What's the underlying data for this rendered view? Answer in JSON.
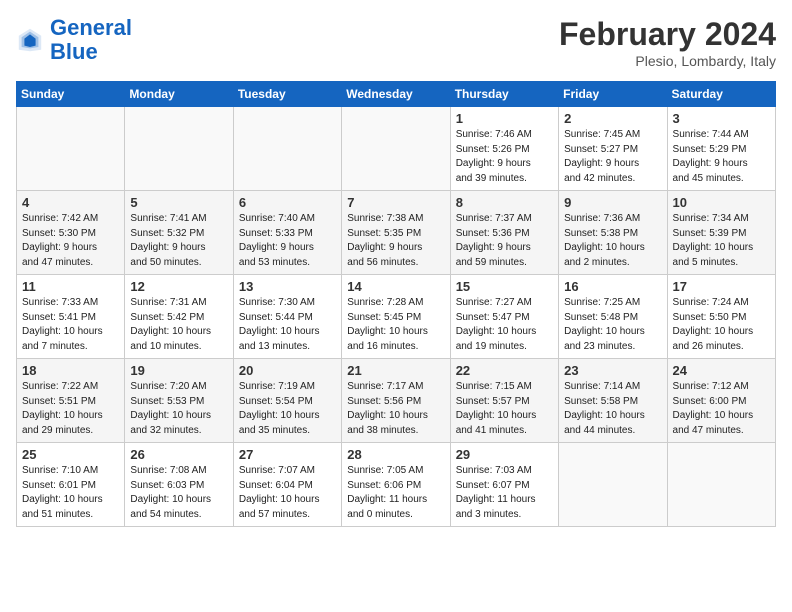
{
  "header": {
    "logo_general": "General",
    "logo_blue": "Blue",
    "month_year": "February 2024",
    "location": "Plesio, Lombardy, Italy"
  },
  "days_of_week": [
    "Sunday",
    "Monday",
    "Tuesday",
    "Wednesday",
    "Thursday",
    "Friday",
    "Saturday"
  ],
  "weeks": [
    [
      {
        "day": "",
        "info": ""
      },
      {
        "day": "",
        "info": ""
      },
      {
        "day": "",
        "info": ""
      },
      {
        "day": "",
        "info": ""
      },
      {
        "day": "1",
        "info": "Sunrise: 7:46 AM\nSunset: 5:26 PM\nDaylight: 9 hours\nand 39 minutes."
      },
      {
        "day": "2",
        "info": "Sunrise: 7:45 AM\nSunset: 5:27 PM\nDaylight: 9 hours\nand 42 minutes."
      },
      {
        "day": "3",
        "info": "Sunrise: 7:44 AM\nSunset: 5:29 PM\nDaylight: 9 hours\nand 45 minutes."
      }
    ],
    [
      {
        "day": "4",
        "info": "Sunrise: 7:42 AM\nSunset: 5:30 PM\nDaylight: 9 hours\nand 47 minutes."
      },
      {
        "day": "5",
        "info": "Sunrise: 7:41 AM\nSunset: 5:32 PM\nDaylight: 9 hours\nand 50 minutes."
      },
      {
        "day": "6",
        "info": "Sunrise: 7:40 AM\nSunset: 5:33 PM\nDaylight: 9 hours\nand 53 minutes."
      },
      {
        "day": "7",
        "info": "Sunrise: 7:38 AM\nSunset: 5:35 PM\nDaylight: 9 hours\nand 56 minutes."
      },
      {
        "day": "8",
        "info": "Sunrise: 7:37 AM\nSunset: 5:36 PM\nDaylight: 9 hours\nand 59 minutes."
      },
      {
        "day": "9",
        "info": "Sunrise: 7:36 AM\nSunset: 5:38 PM\nDaylight: 10 hours\nand 2 minutes."
      },
      {
        "day": "10",
        "info": "Sunrise: 7:34 AM\nSunset: 5:39 PM\nDaylight: 10 hours\nand 5 minutes."
      }
    ],
    [
      {
        "day": "11",
        "info": "Sunrise: 7:33 AM\nSunset: 5:41 PM\nDaylight: 10 hours\nand 7 minutes."
      },
      {
        "day": "12",
        "info": "Sunrise: 7:31 AM\nSunset: 5:42 PM\nDaylight: 10 hours\nand 10 minutes."
      },
      {
        "day": "13",
        "info": "Sunrise: 7:30 AM\nSunset: 5:44 PM\nDaylight: 10 hours\nand 13 minutes."
      },
      {
        "day": "14",
        "info": "Sunrise: 7:28 AM\nSunset: 5:45 PM\nDaylight: 10 hours\nand 16 minutes."
      },
      {
        "day": "15",
        "info": "Sunrise: 7:27 AM\nSunset: 5:47 PM\nDaylight: 10 hours\nand 19 minutes."
      },
      {
        "day": "16",
        "info": "Sunrise: 7:25 AM\nSunset: 5:48 PM\nDaylight: 10 hours\nand 23 minutes."
      },
      {
        "day": "17",
        "info": "Sunrise: 7:24 AM\nSunset: 5:50 PM\nDaylight: 10 hours\nand 26 minutes."
      }
    ],
    [
      {
        "day": "18",
        "info": "Sunrise: 7:22 AM\nSunset: 5:51 PM\nDaylight: 10 hours\nand 29 minutes."
      },
      {
        "day": "19",
        "info": "Sunrise: 7:20 AM\nSunset: 5:53 PM\nDaylight: 10 hours\nand 32 minutes."
      },
      {
        "day": "20",
        "info": "Sunrise: 7:19 AM\nSunset: 5:54 PM\nDaylight: 10 hours\nand 35 minutes."
      },
      {
        "day": "21",
        "info": "Sunrise: 7:17 AM\nSunset: 5:56 PM\nDaylight: 10 hours\nand 38 minutes."
      },
      {
        "day": "22",
        "info": "Sunrise: 7:15 AM\nSunset: 5:57 PM\nDaylight: 10 hours\nand 41 minutes."
      },
      {
        "day": "23",
        "info": "Sunrise: 7:14 AM\nSunset: 5:58 PM\nDaylight: 10 hours\nand 44 minutes."
      },
      {
        "day": "24",
        "info": "Sunrise: 7:12 AM\nSunset: 6:00 PM\nDaylight: 10 hours\nand 47 minutes."
      }
    ],
    [
      {
        "day": "25",
        "info": "Sunrise: 7:10 AM\nSunset: 6:01 PM\nDaylight: 10 hours\nand 51 minutes."
      },
      {
        "day": "26",
        "info": "Sunrise: 7:08 AM\nSunset: 6:03 PM\nDaylight: 10 hours\nand 54 minutes."
      },
      {
        "day": "27",
        "info": "Sunrise: 7:07 AM\nSunset: 6:04 PM\nDaylight: 10 hours\nand 57 minutes."
      },
      {
        "day": "28",
        "info": "Sunrise: 7:05 AM\nSunset: 6:06 PM\nDaylight: 11 hours\nand 0 minutes."
      },
      {
        "day": "29",
        "info": "Sunrise: 7:03 AM\nSunset: 6:07 PM\nDaylight: 11 hours\nand 3 minutes."
      },
      {
        "day": "",
        "info": ""
      },
      {
        "day": "",
        "info": ""
      }
    ]
  ]
}
